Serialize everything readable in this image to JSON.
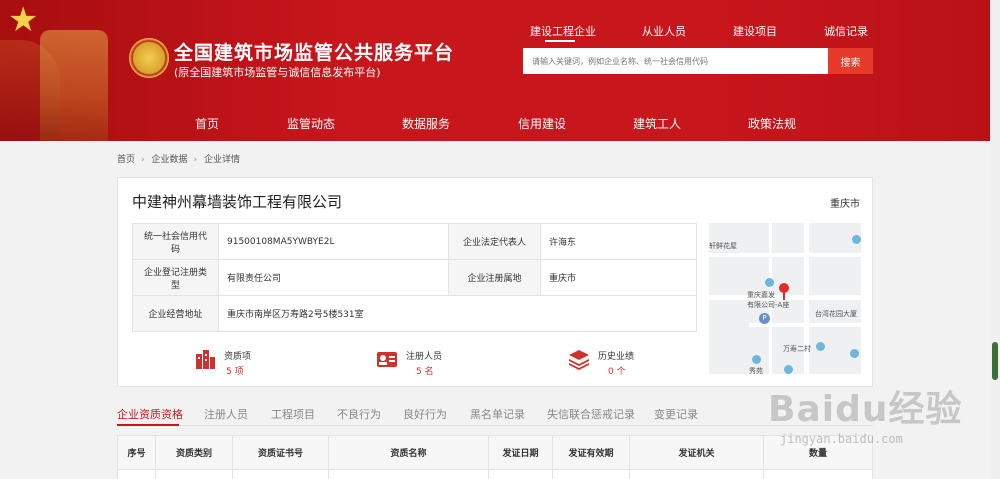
{
  "header": {
    "title": "全国建筑市场监管公共服务平台",
    "subtitle": "(原全国建筑市场监管与诚信信息发布平台)",
    "top_tabs": [
      "建设工程企业",
      "从业人员",
      "建设项目",
      "诚信记录"
    ],
    "search": {
      "placeholder": "请输入关键词，例如企业名称、统一社会信用代码",
      "button": "搜索"
    },
    "nav": [
      "首页",
      "监管动态",
      "数据服务",
      "信用建设",
      "建筑工人",
      "政策法规"
    ]
  },
  "breadcrumb": [
    "首页",
    "企业数据",
    "企业详情"
  ],
  "company": {
    "name": "中建神州幕墙装饰工程有限公司",
    "city": "重庆市",
    "info": {
      "credit_code_label": "统一社会信用代码",
      "credit_code": "91500108MA5YWBYE2L",
      "legal_rep_label": "企业法定代表人",
      "legal_rep": "许海东",
      "reg_type_label": "企业登记注册类型",
      "reg_type": "有限责任公司",
      "reg_place_label": "企业注册属地",
      "reg_place": "重庆市",
      "address_label": "企业经营地址",
      "address": "重庆市南岸区万寿路2号5楼531室"
    },
    "map_labels": [
      "轩鲜花屋",
      "重庆嘉发",
      "有限公司-A座",
      "台湾花园大厦",
      "万寿二村",
      "秀苑"
    ],
    "stats": [
      {
        "label": "资质项",
        "value": "5 项",
        "icon": "building-icon"
      },
      {
        "label": "注册人员",
        "value": "5 名",
        "icon": "id-card-icon"
      },
      {
        "label": "历史业绩",
        "value": "0 个",
        "icon": "layers-icon"
      }
    ]
  },
  "tabs": [
    "企业资质资格",
    "注册人员",
    "工程项目",
    "不良行为",
    "良好行为",
    "黑名单记录",
    "失信联合惩戒记录",
    "变更记录"
  ],
  "qual_table": {
    "headers": [
      "序号",
      "资质类别",
      "资质证书号",
      "资质名称",
      "发证日期",
      "发证有效期",
      "发证机关",
      "数量"
    ]
  },
  "watermark": {
    "main": "Baidu经验",
    "sub": "jingyan.baidu.com"
  },
  "colors": {
    "brand_red": "#c8161d",
    "search_button": "#e83a2a",
    "highlight_value": "#d0312d"
  }
}
